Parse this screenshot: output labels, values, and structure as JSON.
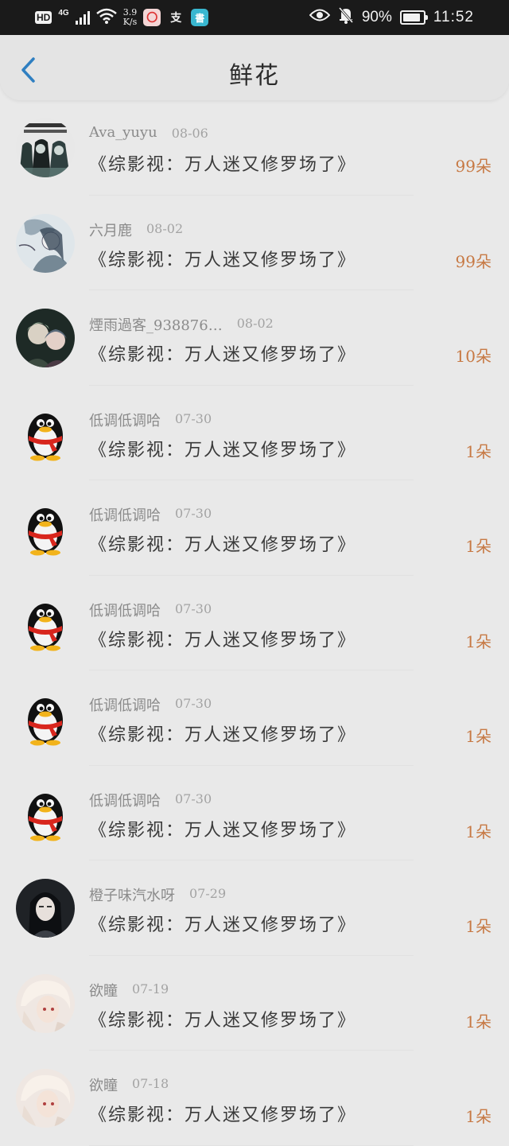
{
  "status_bar": {
    "hd": "HD",
    "network": "4G",
    "speed_value": "3.9",
    "speed_unit": "K/s",
    "app_badge_1": "〇",
    "app_badge_2": "支",
    "app_badge_3": "書",
    "battery": "90%",
    "time": "11:52"
  },
  "header": {
    "title": "鲜花"
  },
  "colors": {
    "accent_blue": "#2f7fc1",
    "count_orange": "#c77944"
  },
  "rows": [
    {
      "user": "Ava_yuyu",
      "date": "08-06",
      "book": "《综影视：万人迷又修罗场了》",
      "count": "99朵",
      "avatar": "group-photo"
    },
    {
      "user": "六月鹿",
      "date": "08-02",
      "book": "《综影视：万人迷又修罗场了》",
      "count": "99朵",
      "avatar": "sketch"
    },
    {
      "user": "煙雨過客_938876…",
      "date": "08-02",
      "book": "《综影视：万人迷又修罗场了》",
      "count": "10朵",
      "avatar": "couple"
    },
    {
      "user": "低调低调哈",
      "date": "07-30",
      "book": "《综影视：万人迷又修罗场了》",
      "count": "1朵",
      "avatar": "penguin"
    },
    {
      "user": "低调低调哈",
      "date": "07-30",
      "book": "《综影视：万人迷又修罗场了》",
      "count": "1朵",
      "avatar": "penguin"
    },
    {
      "user": "低调低调哈",
      "date": "07-30",
      "book": "《综影视：万人迷又修罗场了》",
      "count": "1朵",
      "avatar": "penguin"
    },
    {
      "user": "低调低调哈",
      "date": "07-30",
      "book": "《综影视：万人迷又修罗场了》",
      "count": "1朵",
      "avatar": "penguin"
    },
    {
      "user": "低调低调哈",
      "date": "07-30",
      "book": "《综影视：万人迷又修罗场了》",
      "count": "1朵",
      "avatar": "penguin"
    },
    {
      "user": "橙子味汽水呀",
      "date": "07-29",
      "book": "《综影视：万人迷又修罗场了》",
      "count": "1朵",
      "avatar": "dark-portrait"
    },
    {
      "user": "欲瞳",
      "date": "07-19",
      "book": "《综影视：万人迷又修罗场了》",
      "count": "1朵",
      "avatar": "pale-portrait"
    },
    {
      "user": "欲瞳",
      "date": "07-18",
      "book": "《综影视：万人迷又修罗场了》",
      "count": "1朵",
      "avatar": "pale-portrait"
    }
  ]
}
